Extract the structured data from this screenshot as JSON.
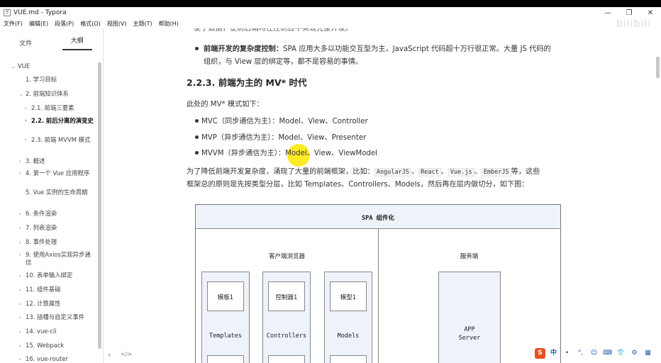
{
  "window": {
    "title": "VUE.md - Typora",
    "app_icon_glyph": "T",
    "controls": [
      "—",
      "❐",
      "✕"
    ]
  },
  "menu": [
    "文件(F)",
    "编辑(E)",
    "段落(P)",
    "格式(O)",
    "视图(V)",
    "主题(T)",
    "帮助(H)"
  ],
  "sidebar": {
    "tabs": [
      "文件",
      "大纲"
    ],
    "active_tab": "大纲",
    "outline": [
      {
        "label": "VUE",
        "caret": "⌄"
      },
      {
        "label": "1. 学习目标",
        "caret": ""
      },
      {
        "label": "2. 前端知识体系",
        "caret": "⌄"
      },
      {
        "label": "2.1. 前端三要素",
        "caret": "›"
      },
      {
        "label": "2.2. 前后分离的演变史",
        "caret": "›"
      },
      {
        "label": "2.3. 前端 MVVM 模式",
        "caret": "›"
      },
      {
        "label": "3. 概述",
        "caret": "›"
      },
      {
        "label": "4. 第一个 Vue 应用程序",
        "caret": "›"
      },
      {
        "label": "5. Vue 实例的生命周期",
        "caret": ""
      },
      {
        "label": "6. 条件渲染",
        "caret": "›"
      },
      {
        "label": "7. 列表渲染",
        "caret": "›"
      },
      {
        "label": "8. 事件处理",
        "caret": "›"
      },
      {
        "label": "9. 使用Axios实现异步通信",
        "caret": "›"
      },
      {
        "label": "10. 表单输入绑定",
        "caret": "›"
      },
      {
        "label": "11. 组件基础",
        "caret": "›"
      },
      {
        "label": "12. 计算属性",
        "caret": "›"
      },
      {
        "label": "13. 插槽与自定义事件",
        "caret": "›"
      },
      {
        "label": "14. vue-cli",
        "caret": "›"
      },
      {
        "label": "15. Webpack",
        "caret": "›"
      },
      {
        "label": "16. vue-router",
        "caret": "›"
      }
    ],
    "footer": {
      "prev": "‹",
      "source": "</>"
    }
  },
  "editor": {
    "partial_top": "便于数据，使前后端均在控制台中实现完整开发。",
    "bullet_top_bold": "前端开发的复杂度控制：",
    "bullet_top_text1": "SPA 应用大多以功能交互型为主，JavaScript 代码超十万行很正常。大量 JS 代码的",
    "bullet_top_text2": "组织，与 View 层的绑定等，都不是容易的事情。",
    "heading": "2.2.3. 前端为主的 MV* 时代",
    "intro": "此处的 MV* 模式如下：",
    "mv_items": [
      "MVC（同步通信为主）：Model、View、Controller",
      "MVP（异步通信为主）：Model、View、Presenter",
      "MVVM（异步通信为主）：Model、View、ViewModel"
    ],
    "para_a": "为了降低前端开发复杂度，涌现了大量的前端框架，比如：",
    "frameworks": [
      "AngularJS",
      "React",
      "Vue.js",
      "EmberJS"
    ],
    "para_sep": "、",
    "para_b": "等，这些",
    "para_c": "框架总的原则是先按类型分层，比如 Templates、Controllers、Models，然后再在层内做切分，如下图："
  },
  "diagram": {
    "title": "SPA 组件化",
    "client": "客户端浏览器",
    "server": "服务端",
    "columns": [
      {
        "box": "模板1",
        "label": "Templates"
      },
      {
        "box": "控制器1",
        "label": "Controllers"
      },
      {
        "box": "模型1",
        "label": "Models"
      }
    ],
    "app_server_line1": "APP",
    "app_server_line2": "Server"
  },
  "overlay": {
    "watermark": "bilibili",
    "tray": [
      "S",
      "中",
      "•",
      "°,",
      "☺",
      "⌨",
      "👕",
      "⚙",
      "▦"
    ]
  }
}
